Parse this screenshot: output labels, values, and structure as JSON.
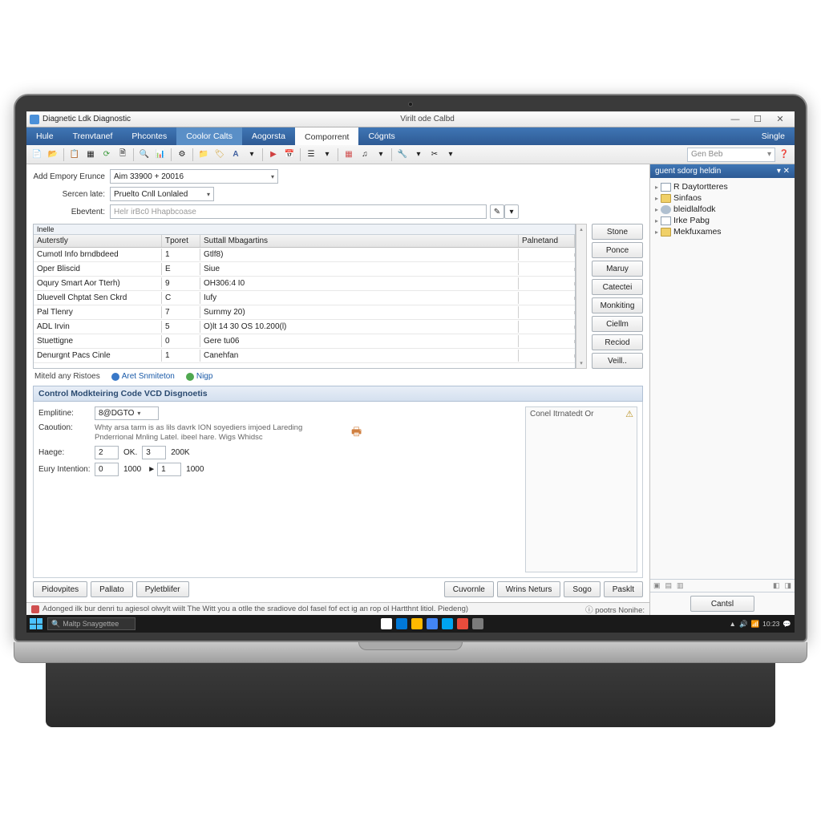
{
  "window": {
    "app_title": "Diagnetic Ldk Diagnostic",
    "doc_title": "Virilt ode Calbd",
    "single_label": "Single"
  },
  "menu": {
    "items": [
      "Hule",
      "Trenvtanef",
      "Phcontes",
      "Coolor Calts",
      "Aogorsta",
      "Comporrent",
      "Cógnts"
    ]
  },
  "toolbar": {
    "search_placeholder": "Gen Beb"
  },
  "form": {
    "row1_label": "Add Empory Erunce",
    "row1_value": "Aim 33900 + 20016",
    "row2_label": "Sercen late:",
    "row2_value": "Pruelto Cnll Lonlaled",
    "row3_label": "Ebevtent:",
    "row3_placeholder": "Helr irBc0 Hhapbcoase"
  },
  "table": {
    "headers": [
      "Auterstly",
      "Tporet",
      "Suttall Mbagartins",
      "Palnetand"
    ],
    "pre_header": "Inelle",
    "rows": [
      {
        "c1": "Cumotl Info brndbdeed",
        "c2": "1",
        "c3": "Gtlf8)",
        "c4": ""
      },
      {
        "c1": "Oper Bliscid",
        "c2": "E",
        "c3": "Siue",
        "c4": ""
      },
      {
        "c1": "Oqury Smart Aor Tterh)",
        "c2": "9",
        "c3": "OH306:4 I0",
        "c4": ""
      },
      {
        "c1": "Dluevell Chptat Sen Ckrd",
        "c2": "C",
        "c3": "Iufy",
        "c4": ""
      },
      {
        "c1": "Pal Tlenry",
        "c2": "7",
        "c3": "Surnmy 20)",
        "c4": ""
      },
      {
        "c1": "ADL Irvin",
        "c2": "5",
        "c3": "O)lt 14 30 OS 10.200(l)",
        "c4": ""
      },
      {
        "c1": "Stuettigne",
        "c2": "0",
        "c3": "Gere tu06",
        "c4": ""
      },
      {
        "c1": "Denurgnt Pacs Cinle",
        "c2": "1",
        "c3": "Canehfan",
        "c4": ""
      }
    ],
    "buttons": [
      "Stone",
      "Ponce",
      "Maruy",
      "Catectei",
      "Monkiting",
      "Ciellm",
      "Reciod",
      "Veill.."
    ]
  },
  "links": {
    "label": "Miteld any Ristoes",
    "link1": "Aret Snmiteton",
    "link2": "Nigp"
  },
  "panel": {
    "title": "Control Modkteiring Code VCD Disgnoetis",
    "emplitine_label": "Emplitine:",
    "emplitine_value": "8@DGTO",
    "caoution_label": "Caoution:",
    "helptext": "Whty arsa tarm is as lils davrk ION soyediers imjoed Lareding Pnderrional Mnling Latel. ibeel hare. Wigs Whidsc",
    "haege_label": "Haege:",
    "haege_v1": "2",
    "haege_u1": "OK.",
    "haege_v2": "3",
    "haege_u2": "200K",
    "eury_label": "Eury Intention:",
    "eury_v1": "0",
    "eury_u1": "1000",
    "eury_v2": "1",
    "eury_u2": "1000",
    "right_title": "Conel Itrnatedt Or"
  },
  "bottom_buttons": {
    "left": [
      "Pidovpites",
      "Pallato",
      "Pyletblifer"
    ],
    "right": [
      "Cuvornle",
      "Wrins Neturs",
      "Sogo",
      "Pasklt"
    ]
  },
  "side": {
    "title": "guent sdorg heldin",
    "items": [
      "R Daytortteres",
      "Sinfaos",
      "bleidlalfodk",
      "Irke Pabg",
      "Mekfuxames"
    ],
    "cancel": "Cantsl"
  },
  "status": {
    "text": "Adonged ilk bur denri tu agiesol olwylt wiilt The Witt you a otlle the sradiove dol fasel fof ect ig an rop ol Hartthnt litiol. Piedeng)",
    "right": "pootrs Nonihe:"
  },
  "taskbar": {
    "search": "Maltp Snaygettee",
    "time": "10:23"
  }
}
